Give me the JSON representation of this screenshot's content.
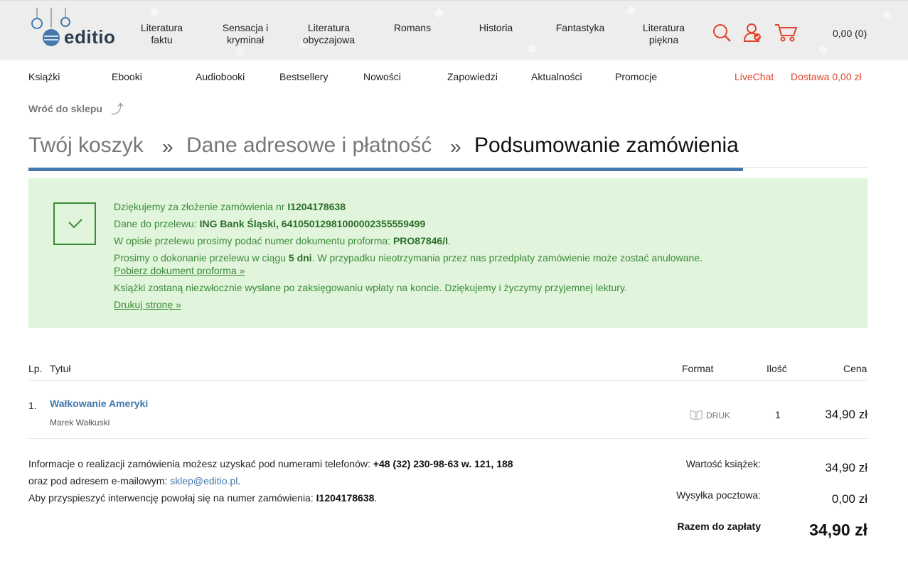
{
  "header": {
    "logo_text": "editio",
    "categories": [
      {
        "line1": "Literatura",
        "line2": "faktu"
      },
      {
        "line1": "Sensacja i",
        "line2": "kryminał"
      },
      {
        "line1": "Literatura",
        "line2": "obyczajowa"
      },
      {
        "line1": "Romans",
        "line2": ""
      },
      {
        "line1": "Historia",
        "line2": ""
      },
      {
        "line1": "Fantastyka",
        "line2": ""
      },
      {
        "line1": "Literatura",
        "line2": "piękna"
      }
    ],
    "cart_value": "0,00 (0)",
    "icon_color": "#e2452d"
  },
  "nav": {
    "items": [
      "Książki",
      "Ebooki",
      "Audiobooki",
      "Bestsellery",
      "Nowości",
      "Zapowiedzi",
      "Aktualności",
      "Promocje"
    ],
    "livechat": "LiveChat",
    "delivery": "Dostawa 0,00 zł"
  },
  "back_link": "Wróć do sklepu",
  "steps": {
    "step1": "Twój koszyk",
    "step2": "Dane adresowe i płatność",
    "step3": "Podsumowanie zamówienia",
    "separator": "»"
  },
  "success": {
    "line1_prefix": "Dziękujemy za złożenie zamówienia nr ",
    "order_no": "I1204178638",
    "line2_prefix": "Dane do przelewu: ",
    "bank": "ING Bank Śląski, 64105012981000002355559499",
    "line3_prefix": "W opisie przelewu prosimy podać numer dokumentu proforma: ",
    "proforma": "PRO87846/I",
    "line3_suffix": ".",
    "line4_prefix": "Prosimy o dokonanie przelewu w ciągu ",
    "days": "5 dni",
    "line4_suffix": ". W przypadku nieotrzymania przez nas przedpłaty zamówienie może zostać anulowane.",
    "proforma_link": "Pobierz dokument proforma »",
    "line6": "Książki zostaną niezwłocznie wysłane po zaksięgowaniu wpłaty na koncie. Dziękujemy i życzymy przyjemnej lektury.",
    "print_link": "Drukuj stronę »",
    "bg_color": "#e0f5db",
    "text_color": "#3d8a3a"
  },
  "table": {
    "headers": {
      "lp": "Lp.",
      "title": "Tytuł",
      "format": "Format",
      "qty": "Ilość",
      "price": "Cena"
    },
    "rows": [
      {
        "lp": "1.",
        "title": "Wałkowanie Ameryki",
        "author": "Marek Wałkuski",
        "format": "DRUK",
        "qty": "1",
        "price": "34,90 zł"
      }
    ]
  },
  "info": {
    "line1_prefix": "Informacje o realizacji zamówienia możesz uzyskać pod numerami telefonów: ",
    "phones": "+48 (32) 230-98-63 w. 121, 188",
    "line2_prefix": "oraz pod adresem e-mailowym: ",
    "email": "sklep@editio.pl",
    "line2_suffix": ".",
    "line3_prefix": "Aby przyspieszyć interwencję powołaj się na numer zamówienia: ",
    "order_no": "I1204178638",
    "line3_suffix": "."
  },
  "totals": {
    "books_label": "Wartość książek:",
    "books_value": "34,90 zł",
    "shipping_label": "Wysyłka pocztowa:",
    "shipping_value": "0,00 zł",
    "total_label": "Razem do zapłaty",
    "total_value": "34,90 zł"
  }
}
